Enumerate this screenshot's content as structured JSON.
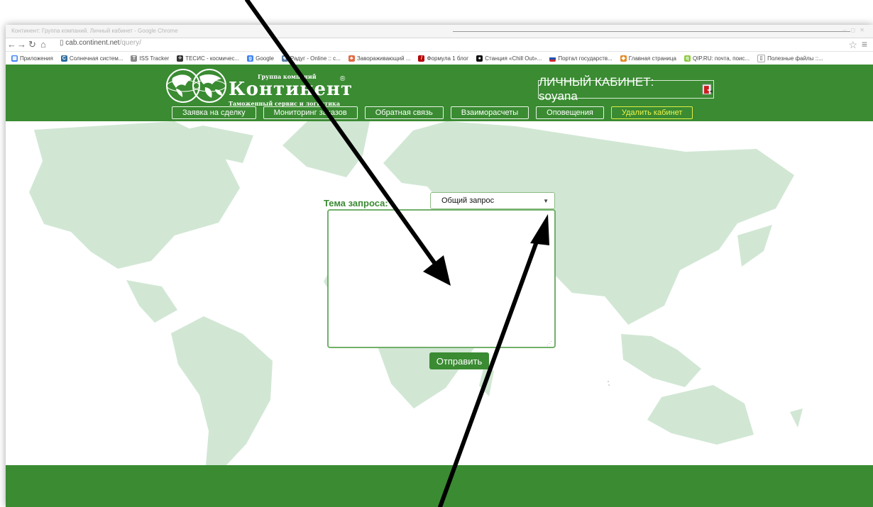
{
  "browser": {
    "tab_title": "Континент: Группа компаний. Личный кабинет - Google Chrome",
    "window_controls": "– ◻ ✕",
    "address": {
      "domain": "cab.continent.net",
      "path": "/query/"
    },
    "bookmarks": [
      {
        "label": "Приложения",
        "icon": "apps-icon"
      },
      {
        "label": "Солнечная систем...",
        "icon": "solar-system-icon"
      },
      {
        "label": "ISS Tracker",
        "icon": "iss-icon"
      },
      {
        "label": "ТЕСИС - космичес...",
        "icon": "tesis-icon"
      },
      {
        "label": "Google",
        "icon": "google-icon"
      },
      {
        "label": "Радуг - Online :: с...",
        "icon": "radug-icon"
      },
      {
        "label": "Завораживающий ...",
        "icon": "tree-icon"
      },
      {
        "label": "Формула 1 блог",
        "icon": "formula-icon"
      },
      {
        "label": "Станция «Chill Out»...",
        "icon": "radio-icon"
      },
      {
        "label": "Портал государств...",
        "icon": "flag-icon"
      },
      {
        "label": "Главная страница",
        "icon": "home-icon"
      },
      {
        "label": "QIP.RU: почта, поис...",
        "icon": "qip-icon"
      },
      {
        "label": "Полезные файлы ::...",
        "icon": "file-icon"
      }
    ]
  },
  "site": {
    "logo": {
      "small": "Группа компаний",
      "main": "Континент",
      "registered": "®",
      "subtitle": "Таможенный сервис и логистика"
    },
    "cabinet_label": "ЛИЧНЫЙ КАБИНЕТ: soyana",
    "nav": [
      {
        "label": "Заявка на сделку"
      },
      {
        "label": "Мониторинг заказов"
      },
      {
        "label": "Обратная связь"
      },
      {
        "label": "Взаиморасчеты"
      },
      {
        "label": "Оповещения"
      },
      {
        "label": "Удалить кабинет"
      }
    ],
    "form": {
      "topic_label": "Тема запроса:",
      "topic_value": "Общий запрос",
      "message_value": "",
      "submit_label": "Отправить"
    }
  },
  "colors": {
    "brand_green": "#3a8b32",
    "map_green": "#d1e7d4",
    "active_nav": "#eef34a"
  }
}
